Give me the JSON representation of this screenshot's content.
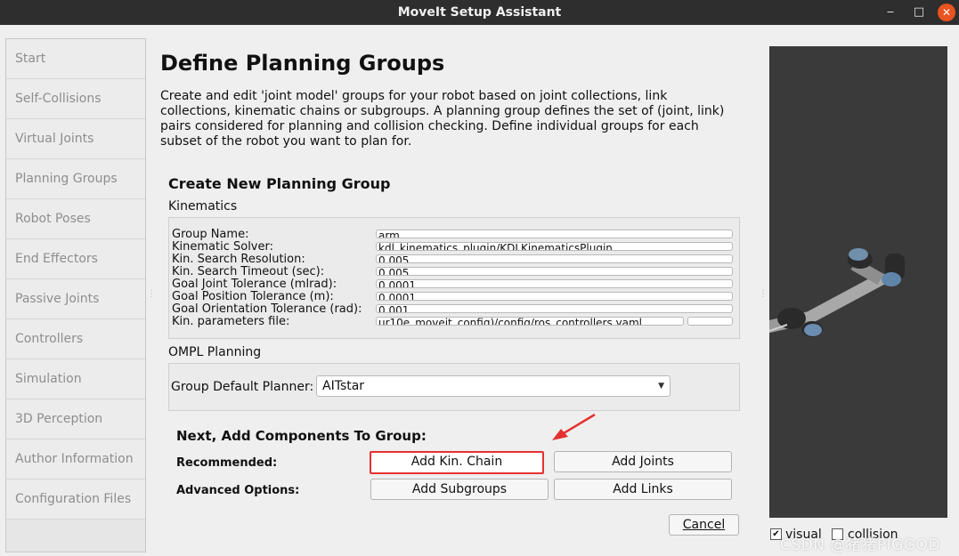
{
  "window": {
    "title": "MoveIt Setup Assistant",
    "minimize": "‒",
    "maximize": "□",
    "close": "✕"
  },
  "sidebar": {
    "items": [
      {
        "label": "Start"
      },
      {
        "label": "Self-Collisions"
      },
      {
        "label": "Virtual Joints"
      },
      {
        "label": "Planning Groups"
      },
      {
        "label": "Robot Poses"
      },
      {
        "label": "End Effectors"
      },
      {
        "label": "Passive Joints"
      },
      {
        "label": "Controllers"
      },
      {
        "label": "Simulation"
      },
      {
        "label": "3D Perception"
      },
      {
        "label": "Author Information"
      },
      {
        "label": "Configuration Files"
      }
    ]
  },
  "page": {
    "title": "Define Planning Groups",
    "description": "Create and edit 'joint model' groups for your robot based on joint collections, link collections, kinematic chains or subgroups. A planning group defines the set of (joint, link) pairs considered for planning and collision checking. Define individual groups for each subset of the robot you want to plan for."
  },
  "create": {
    "title": "Create New Planning Group",
    "kinematics_label": "Kinematics",
    "rows": [
      {
        "label": "Group Name:",
        "value": "arm"
      },
      {
        "label": "Kinematic Solver:",
        "value": "kdl_kinematics_plugin/KDLKinematicsPlugin"
      },
      {
        "label": "Kin. Search Resolution:",
        "value": "0.005"
      },
      {
        "label": "Kin. Search Timeout (sec):",
        "value": "0.005"
      },
      {
        "label": "Goal Joint Tolerance (mlrad):",
        "value": "0.0001"
      },
      {
        "label": "Goal Position Tolerance (m):",
        "value": "0.0001"
      },
      {
        "label": "Goal Orientation Tolerance (rad):",
        "value": "0.001"
      },
      {
        "label": "Kin. parameters file:",
        "value": "ur10e_moveit_config)/config/ros_controllers.yaml"
      }
    ],
    "ompl_label": "OMPL Planning",
    "planner_label": "Group Default Planner:",
    "planner_value": "AITstar"
  },
  "components": {
    "title": "Next, Add Components To Group:",
    "recommended_label": "Recommended:",
    "advanced_label": "Advanced Options:",
    "add_kin_chain": "Add Kin. Chain",
    "add_joints": "Add Joints",
    "add_subgroups": "Add Subgroups",
    "add_links": "Add Links"
  },
  "cancel": "Cancel",
  "viewer": {
    "visual_label": "visual",
    "visual_checked": true,
    "collision_label": "collision",
    "collision_checked": false
  },
  "watermark": "CSDN @猪猪PIGGOD",
  "colors": {
    "highlight": "#e53030",
    "viewport_bg": "#3a3a3a",
    "titlebar_bg": "#2e2e2e",
    "close_btn": "#e95420"
  }
}
